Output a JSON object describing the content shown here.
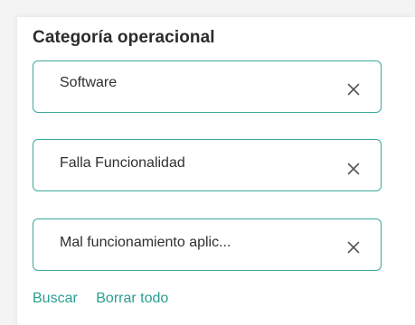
{
  "filter": {
    "title": "Categoría operacional",
    "fields": [
      {
        "value": "Software",
        "clear_icon": "close-icon"
      },
      {
        "value": "Falla Funcionalidad",
        "clear_icon": "close-icon"
      },
      {
        "value": "Mal funcionamiento aplic...",
        "clear_icon": "close-icon"
      }
    ],
    "actions": {
      "search_label": "Buscar",
      "clear_all_label": "Borrar todo"
    }
  },
  "colors": {
    "accent": "#2a9d8f",
    "border": "#3aa99d",
    "text": "#2f2f2f",
    "icon": "#555555"
  }
}
